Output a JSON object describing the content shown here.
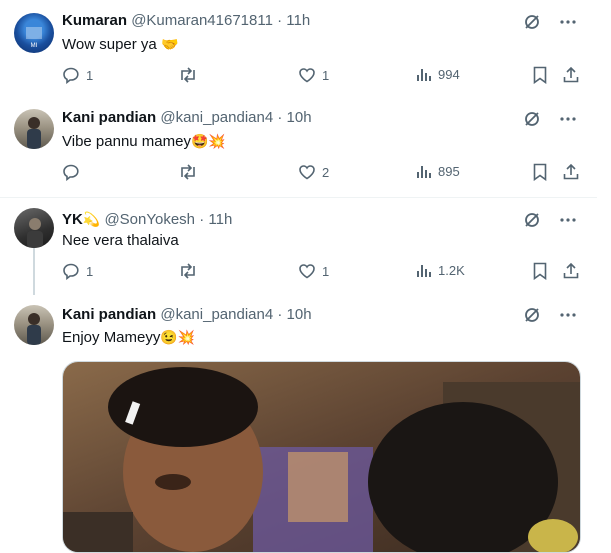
{
  "tweets": [
    {
      "name": "Kumaran",
      "handle": "@Kumaran41671811",
      "time": "11h",
      "text": "Wow super ya",
      "emojis": "🤝",
      "replies": "1",
      "likes": "1",
      "views": "994"
    },
    {
      "name": "Kani pandian",
      "handle": "@kani_pandian4",
      "time": "10h",
      "text": "Vibe pannu mamey",
      "emojis": "🤩💥",
      "replies": "",
      "likes": "2",
      "views": "895"
    },
    {
      "name": "YK",
      "name_emoji": "💫",
      "handle": "@SonYokesh",
      "time": "11h",
      "text": "Nee vera thalaiva",
      "emojis": "",
      "replies": "1",
      "likes": "1",
      "views": "1.2K"
    },
    {
      "name": "Kani pandian",
      "handle": "@kani_pandian4",
      "time": "10h",
      "text": "Enjoy Mameyy",
      "emojis": "😉💥"
    }
  ],
  "separator": "·",
  "icons": [
    "grok-icon",
    "more-icon",
    "reply-icon",
    "repost-icon",
    "like-icon",
    "views-icon",
    "bookmark-icon",
    "share-icon"
  ],
  "colors": {
    "text": "#0f1419",
    "muted": "#536471",
    "divider": "#eff3f4"
  }
}
